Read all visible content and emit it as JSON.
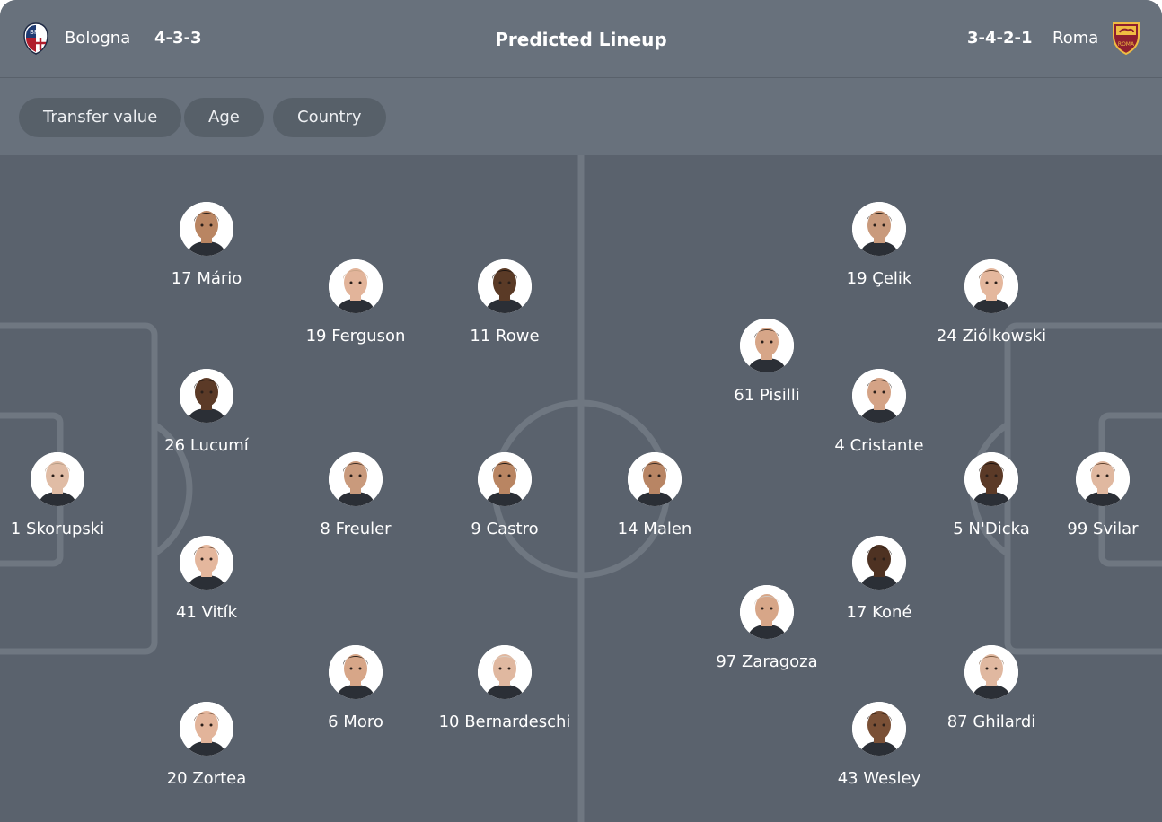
{
  "header": {
    "title": "Predicted Lineup",
    "home": {
      "name": "Bologna",
      "formation": "4-3-3",
      "crest_icon": "bologna-crest-icon"
    },
    "away": {
      "name": "Roma",
      "formation": "3-4-2-1",
      "crest_icon": "roma-crest-icon"
    }
  },
  "filters": [
    "Transfer value",
    "Age",
    "Country"
  ],
  "colors": {
    "background": "#5a626d",
    "header": "#68717c",
    "chip": "#576069",
    "lines": "#6f7781",
    "text": "#ffffff"
  },
  "home_players": [
    {
      "label": "17 Mário",
      "skin": "#b98562",
      "hair": "#2a1f1a"
    },
    {
      "label": "19 Ferguson",
      "skin": "#e2b49a",
      "hair": "#c9a487"
    },
    {
      "label": "11 Rowe",
      "skin": "#5a3a26",
      "hair": "#1c1410"
    },
    {
      "label": "26 Lucumí",
      "skin": "#5b3a27",
      "hair": "#1c1410"
    },
    {
      "label": "1 Skorupski",
      "skin": "#e0bca5",
      "hair": "#b39b84"
    },
    {
      "label": "8 Freuler",
      "skin": "#c99a7c",
      "hair": "#3a2c24"
    },
    {
      "label": "9 Castro",
      "skin": "#b98562",
      "hair": "#1f1915"
    },
    {
      "label": "41 Vitík",
      "skin": "#e4b79d",
      "hair": "#4a3528"
    },
    {
      "label": "6 Moro",
      "skin": "#d7a688",
      "hair": "#2d231d"
    },
    {
      "label": "10 Bernardeschi",
      "skin": "#e0b8a0",
      "hair": "#d7cfc6"
    },
    {
      "label": "20 Zortea",
      "skin": "#e2b49a",
      "hair": "#6b4a36"
    }
  ],
  "away_players": [
    {
      "label": "14 Malen",
      "skin": "#b88564",
      "hair": "#3a2c24"
    },
    {
      "label": "19 Çelik",
      "skin": "#c99a7c",
      "hair": "#2a2019"
    },
    {
      "label": "24 Ziólkowski",
      "skin": "#e4b79d",
      "hair": "#5a3f2c"
    },
    {
      "label": "61 Pisilli",
      "skin": "#d7a688",
      "hair": "#3a2c24"
    },
    {
      "label": "4 Cristante",
      "skin": "#d4a386",
      "hair": "#2d231d"
    },
    {
      "label": "5 N'Dicka",
      "skin": "#5b3a27",
      "hair": "#1c1410"
    },
    {
      "label": "99 Svilar",
      "skin": "#e0b8a0",
      "hair": "#5a3f2c"
    },
    {
      "label": "17 Koné",
      "skin": "#4e3222",
      "hair": "#1a120e"
    },
    {
      "label": "97 Zaragoza",
      "skin": "#d7a688",
      "hair": "#cfc7bf"
    },
    {
      "label": "87 Ghilardi",
      "skin": "#e0b8a0",
      "hair": "#7a5a40"
    },
    {
      "label": "43 Wesley",
      "skin": "#7a5036",
      "hair": "#1c1410"
    }
  ]
}
